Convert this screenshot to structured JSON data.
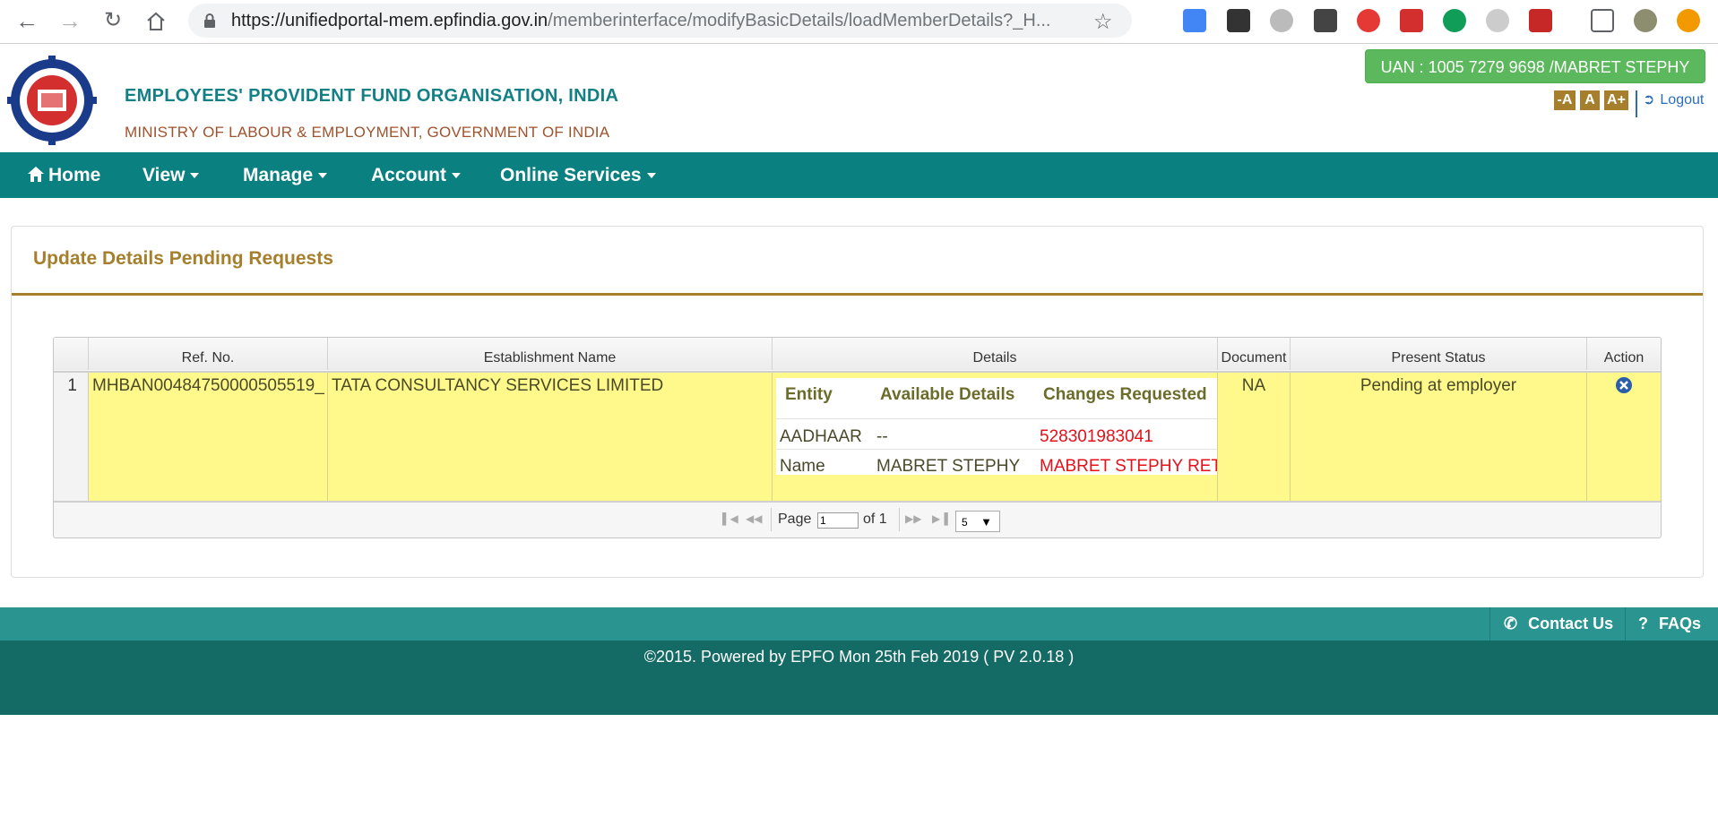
{
  "browser": {
    "url_host": "https://unifiedportal-mem.epfindia.gov.in",
    "url_path": "/memberinterface/modifyBasicDetails/loadMemberDetails?_H..."
  },
  "header": {
    "org_name": "EMPLOYEES' PROVIDENT FUND ORGANISATION, INDIA",
    "ministry": "MINISTRY OF LABOUR & EMPLOYMENT, GOVERNMENT OF INDIA",
    "uan_badge": "UAN : 1005 7279 9698 /MABRET STEPHY",
    "font_decrease": "-A",
    "font_normal": "A",
    "font_increase": "A+",
    "logout": "Logout"
  },
  "nav": {
    "home": "Home",
    "view": "View",
    "manage": "Manage",
    "account": "Account",
    "online_services": "Online Services"
  },
  "panel": {
    "title": "Update Details Pending Requests"
  },
  "grid": {
    "headers": {
      "ref_no": "Ref. No.",
      "establishment": "Establishment Name",
      "details": "Details",
      "document": "Document",
      "status": "Present Status",
      "action": "Action"
    },
    "row": {
      "num": "1",
      "ref_no": "MHBAN00484750000505519_",
      "establishment": "TATA CONSULTANCY SERVICES LIMITED",
      "document": "NA",
      "status": "Pending at employer"
    },
    "details": {
      "headers": {
        "entity": "Entity",
        "available": "Available Details",
        "changes": "Changes Requested"
      },
      "rows": [
        {
          "entity": "AADHAAR",
          "available": "--",
          "changes": "528301983041"
        },
        {
          "entity": "Name",
          "available": "MABRET STEPHY",
          "changes": "MABRET STEPHY RET"
        }
      ]
    },
    "pager": {
      "page_label": "Page",
      "page_value": "1",
      "of_label": "of 1",
      "page_size": "5"
    }
  },
  "footer": {
    "contact": "Contact Us",
    "faqs": "FAQs",
    "copyright": "©2015. Powered by EPFO Mon 25th Feb 2019 ( PV 2.0.18 )"
  },
  "colors": {
    "teal_nav": "#0b8080",
    "gold": "#a57f2c",
    "green_badge": "#5cb85c",
    "row_yellow": "#fef98a",
    "change_red": "#e5101a"
  }
}
